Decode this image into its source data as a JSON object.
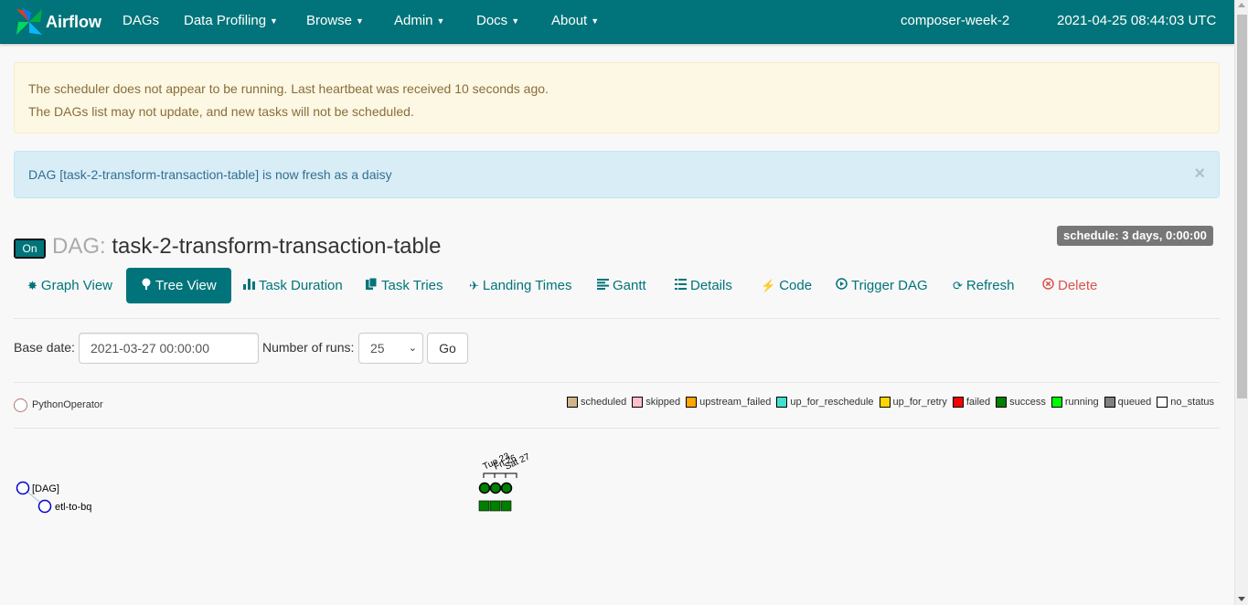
{
  "navbar": {
    "brand": "Airflow",
    "items": [
      "DAGs",
      "Data Profiling",
      "Browse",
      "Admin",
      "Docs",
      "About"
    ],
    "environment": "composer-week-2",
    "clock": "2021-04-25 08:44:03 UTC"
  },
  "alerts": {
    "warning_line1": "The scheduler does not appear to be running. Last heartbeat was received 10 seconds ago.",
    "warning_line2": "The DAGs list may not update, and new tasks will not be scheduled.",
    "info": "DAG [task-2-transform-transaction-table] is now fresh as a daisy",
    "close": "×"
  },
  "dag": {
    "toggle": "On",
    "label": "DAG:",
    "name": "task-2-transform-transaction-table",
    "schedule": "schedule: 3 days, 0:00:00"
  },
  "tabs": [
    {
      "label": "Graph View",
      "icon": "asterisk-icon"
    },
    {
      "label": "Tree View",
      "icon": "tree-icon"
    },
    {
      "label": "Task Duration",
      "icon": "bar-chart-icon"
    },
    {
      "label": "Task Tries",
      "icon": "files-icon"
    },
    {
      "label": "Landing Times",
      "icon": "plane-icon"
    },
    {
      "label": "Gantt",
      "icon": "align-left-icon"
    },
    {
      "label": "Details",
      "icon": "list-icon"
    },
    {
      "label": "Code",
      "icon": "flash-icon"
    },
    {
      "label": "Trigger DAG",
      "icon": "play-circle-icon"
    },
    {
      "label": "Refresh",
      "icon": "refresh-icon"
    },
    {
      "label": "Delete",
      "icon": "remove-circle-icon"
    }
  ],
  "form": {
    "base_date_label": "Base date:",
    "base_date_value": "2021-03-27 00:00:00",
    "runs_label": "Number of runs:",
    "runs_value": "25",
    "go_label": "Go"
  },
  "legend": {
    "operator": "PythonOperator",
    "operator_color": "#ffefeb",
    "states": [
      {
        "name": "scheduled",
        "color": "#d2b48c"
      },
      {
        "name": "skipped",
        "color": "#ffc0cb"
      },
      {
        "name": "upstream_failed",
        "color": "#ffa500"
      },
      {
        "name": "up_for_reschedule",
        "color": "#40e0d0"
      },
      {
        "name": "up_for_retry",
        "color": "#ffd700"
      },
      {
        "name": "failed",
        "color": "#ff0000"
      },
      {
        "name": "success",
        "color": "#008000"
      },
      {
        "name": "running",
        "color": "#00ff00"
      },
      {
        "name": "queued",
        "color": "#808080"
      },
      {
        "name": "no_status",
        "color": "#ffffff"
      }
    ]
  },
  "tree": {
    "root": "[DAG]",
    "task": "etl-to-bq",
    "run_labels": [
      "Tue 23",
      "Fri 26",
      "Sat 27"
    ],
    "run_states": [
      "success",
      "success",
      "success"
    ],
    "task_states": [
      "success",
      "success",
      "success"
    ]
  }
}
